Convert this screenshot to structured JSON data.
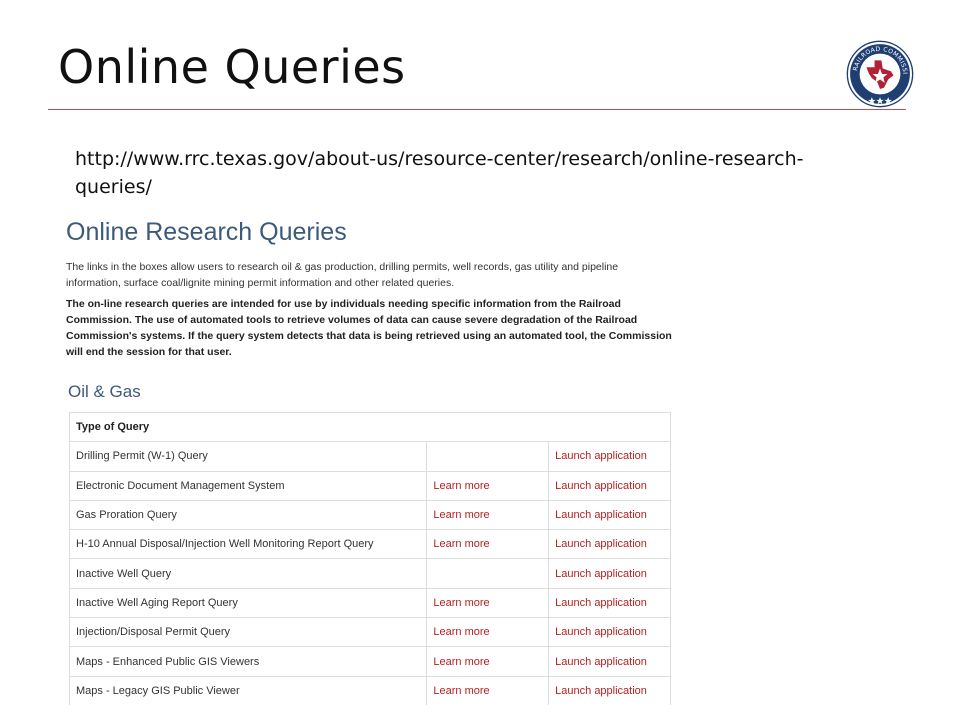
{
  "slide": {
    "title": "Online Queries",
    "url_line1": "http://www.rrc.texas.gov/about-us/resource-center/research/online-research-",
    "url_line2": "queries/",
    "seal_text": "RAILROAD COMMISSION OF TEXAS"
  },
  "page": {
    "heading": "Online Research Queries",
    "intro": "The links in the boxes allow users to research oil & gas production, drilling permits, well records, gas utility and pipeline information, surface coal/lignite mining permit information and other related queries.",
    "notice": "The on-line research queries are intended for use by individuals needing specific information from the Railroad Commission. The use of automated tools to retrieve volumes of data can cause severe degradation of the Railroad Commission's systems. If the query system detects that data is being retrieved using an automated tool, the Commission will end the session for that user.",
    "section": "Oil & Gas",
    "table_header": "Type of Query",
    "rows": [
      {
        "name": "Drilling Permit (W-1) Query",
        "learn": "",
        "launch": "Launch application"
      },
      {
        "name": "Electronic Document Management System",
        "learn": "Learn more",
        "launch": "Launch application"
      },
      {
        "name": "Gas Proration Query",
        "learn": "Learn more",
        "launch": "Launch application"
      },
      {
        "name": "H-10 Annual Disposal/Injection Well Monitoring Report Query",
        "learn": "Learn more",
        "launch": "Launch application"
      },
      {
        "name": "Inactive Well Query",
        "learn": "",
        "launch": "Launch application"
      },
      {
        "name": "Inactive Well Aging Report Query",
        "learn": "Learn more",
        "launch": "Launch application"
      },
      {
        "name": "Injection/Disposal Permit Query",
        "learn": "Learn more",
        "launch": "Launch application"
      },
      {
        "name": "Maps - Enhanced Public GIS Viewers",
        "learn": "Learn more",
        "launch": "Launch application"
      },
      {
        "name": "Maps - Legacy GIS Public Viewer",
        "learn": "Learn more",
        "launch": "Launch application"
      }
    ]
  },
  "colors": {
    "accent_rule": "#c0504d",
    "heading_blue": "#3e5a7a",
    "link_red": "#b22222",
    "seal_blue": "#1f3f73"
  }
}
